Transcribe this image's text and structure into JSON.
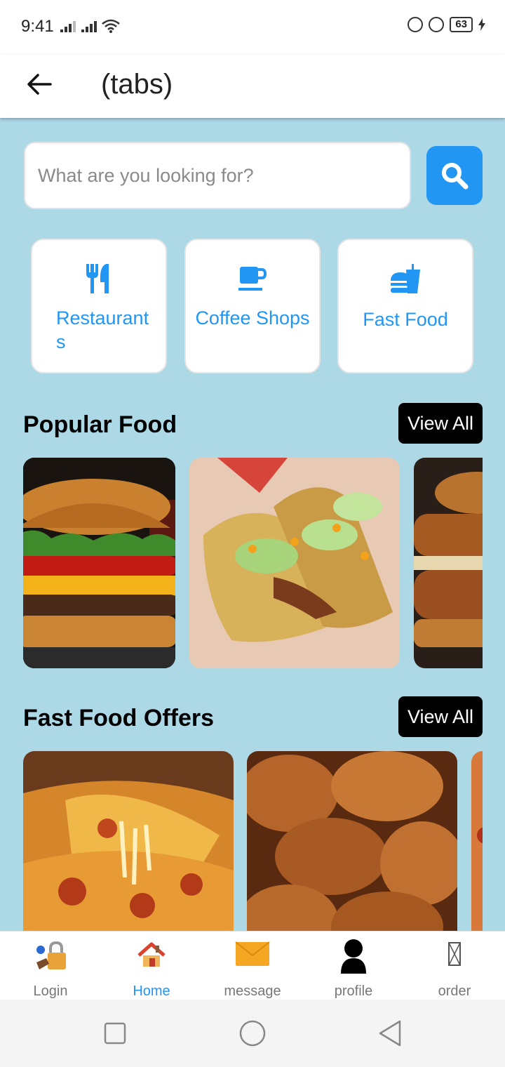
{
  "status_bar": {
    "time": "9:41",
    "battery": "63"
  },
  "header": {
    "title": "(tabs)"
  },
  "search": {
    "placeholder": "What are you looking for?"
  },
  "categories": [
    {
      "label": "Restaurants",
      "icon": "utensils-icon"
    },
    {
      "label": "Coffee Shops",
      "icon": "coffee-cup-icon"
    },
    {
      "label": "Fast Food",
      "icon": "burger-drink-icon"
    }
  ],
  "popular": {
    "title": "Popular Food",
    "view_all": "View All"
  },
  "offers": {
    "title": "Fast Food Offers",
    "view_all": "View All"
  },
  "nav": {
    "items": [
      {
        "label": "Login",
        "icon": "lock-key-icon"
      },
      {
        "label": "Home",
        "icon": "house-icon",
        "active": true
      },
      {
        "label": "message",
        "icon": "envelope-icon"
      },
      {
        "label": "profile",
        "icon": "person-icon"
      },
      {
        "label": "order",
        "icon": "missing-glyph-icon"
      }
    ]
  },
  "colors": {
    "accent": "#2196f3",
    "background": "#add8e6"
  }
}
